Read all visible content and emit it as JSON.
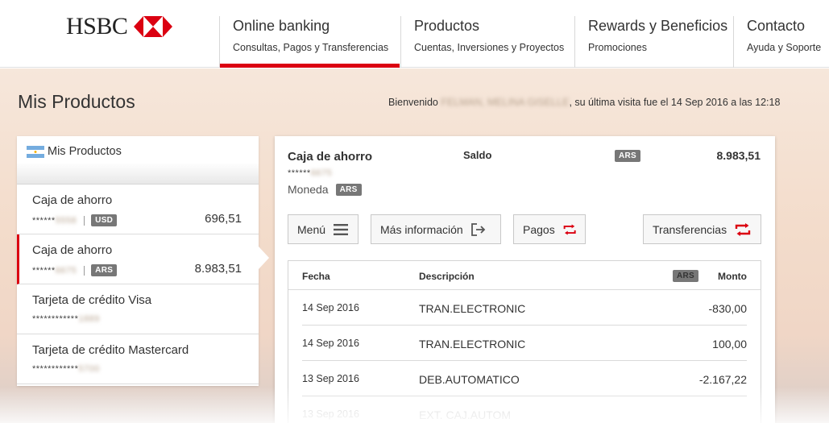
{
  "header": {
    "logo_text": "HSBC",
    "nav": [
      {
        "title": "Online banking",
        "sub": "Consultas, Pagos y Transferencias"
      },
      {
        "title": "Productos",
        "sub": "Cuentas, Inversiones y Proyectos"
      },
      {
        "title": "Rewards y Beneficios",
        "sub": "Promociones"
      },
      {
        "title": "Contacto",
        "sub": "Ayuda y Soporte"
      }
    ]
  },
  "page": {
    "title": "Mis Productos",
    "welcome_prefix": "Bienvenido",
    "welcome_name": "FELMAN, MELINA GISELLE",
    "welcome_suffix": ", su última visita fue el 14 Sep 2016 a las 12:18"
  },
  "sidebar": {
    "title": "Mis Productos",
    "products": [
      {
        "name": "Caja de ahorro",
        "masked": "******",
        "last": "5558",
        "currency": "USD",
        "amount": "696,51"
      },
      {
        "name": "Caja de ahorro",
        "masked": "******",
        "last": "6675",
        "currency": "ARS",
        "amount": "8.983,51"
      },
      {
        "name": "Tarjeta de crédito Visa",
        "masked": "************",
        "last": "1889"
      },
      {
        "name": "Tarjeta de crédito Mastercard",
        "masked": "************",
        "last": "5700"
      }
    ]
  },
  "account": {
    "name": "Caja de ahorro",
    "masked": "******",
    "last": "6675",
    "moneda_label": "Moneda",
    "currency": "ARS",
    "saldo_label": "Saldo",
    "saldo_currency": "ARS",
    "saldo_amount": "8.983,51"
  },
  "actions": {
    "menu": "Menú",
    "info": "Más información",
    "pagos": "Pagos",
    "transferencias": "Transferencias"
  },
  "transactions": {
    "headers": {
      "fecha": "Fecha",
      "descripcion": "Descripción",
      "currency": "ARS",
      "monto": "Monto"
    },
    "rows": [
      {
        "fecha": "14 Sep 2016",
        "desc": "TRAN.ELECTRONIC",
        "monto": "-830,00"
      },
      {
        "fecha": "14 Sep 2016",
        "desc": "TRAN.ELECTRONIC",
        "monto": "100,00"
      },
      {
        "fecha": "13 Sep 2016",
        "desc": "DEB.AUTOMATICO",
        "monto": "-2.167,22"
      },
      {
        "fecha": "13 Sep 2016",
        "desc": "EXT. CAJ.AUTOM",
        "monto": ""
      }
    ]
  },
  "colors": {
    "brand_red": "#db0011",
    "badge_gray": "#777777"
  }
}
